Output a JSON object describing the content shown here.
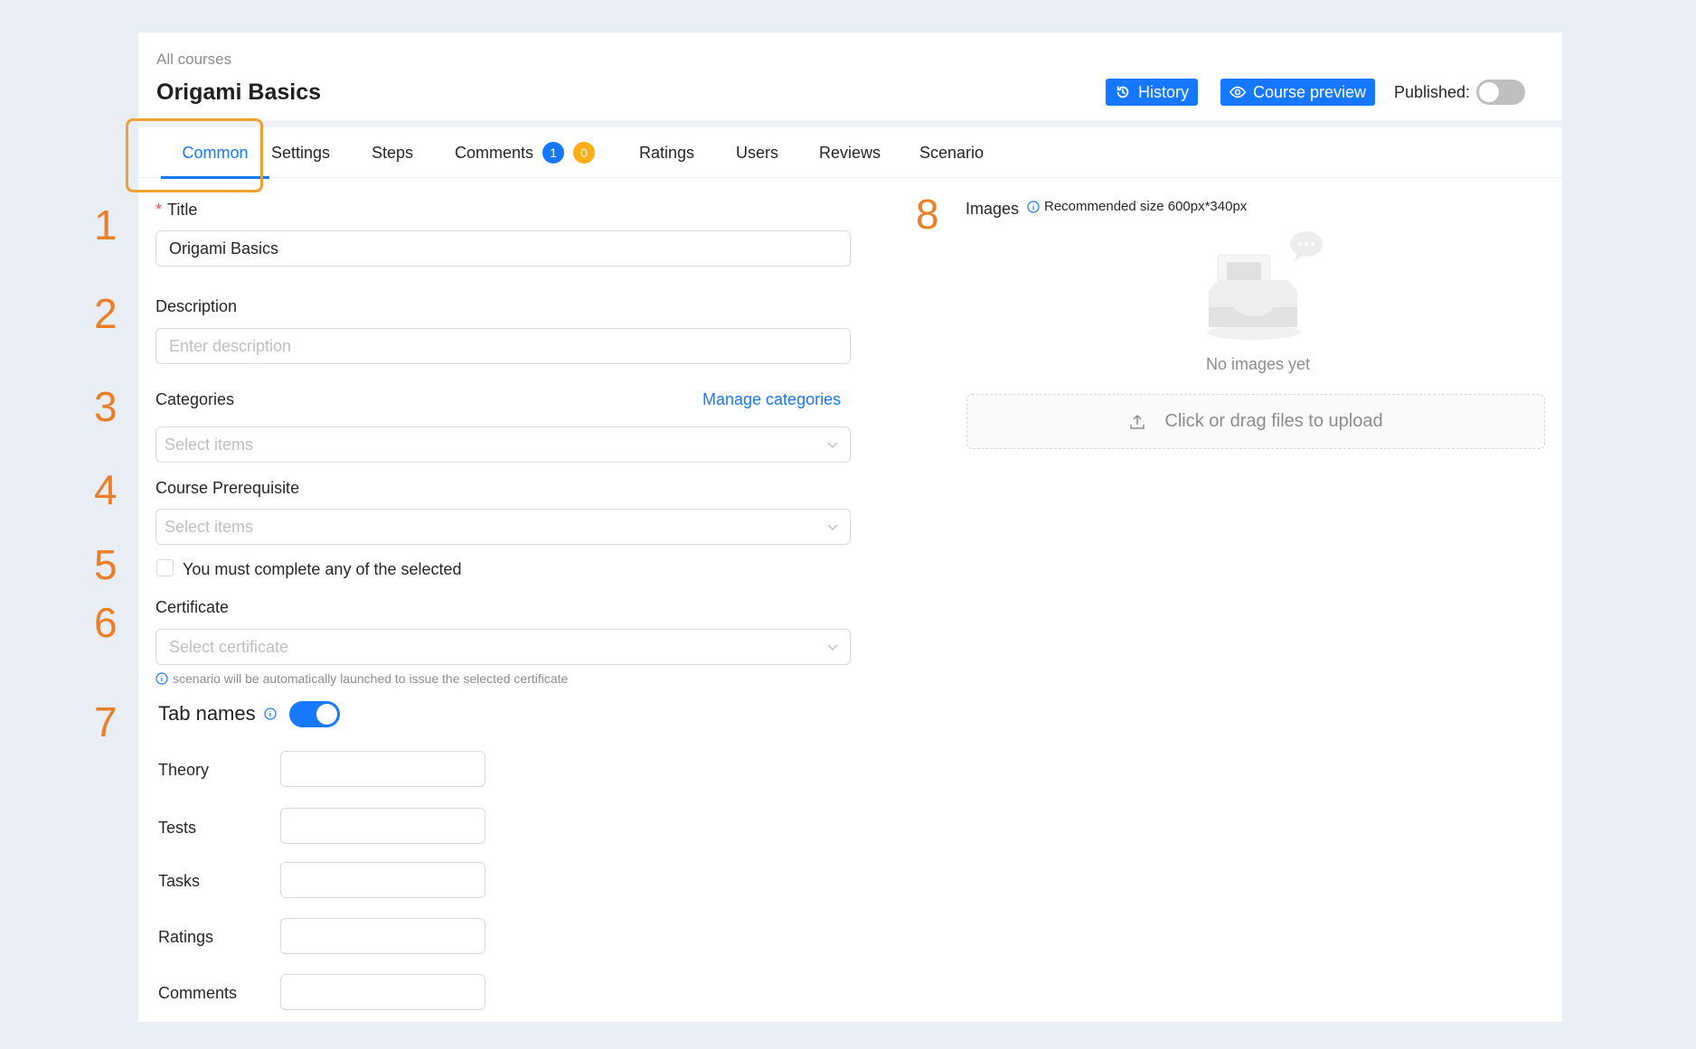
{
  "header": {
    "breadcrumb": "All courses",
    "title": "Origami Basics",
    "history_label": "History",
    "preview_label": "Course preview",
    "published_label": "Published:",
    "published": false
  },
  "tabs": [
    {
      "label": "Common"
    },
    {
      "label": "Settings"
    },
    {
      "label": "Steps"
    },
    {
      "label": "Comments",
      "badges": [
        "1",
        "0"
      ]
    },
    {
      "label": "Ratings"
    },
    {
      "label": "Users"
    },
    {
      "label": "Reviews"
    },
    {
      "label": "Scenario"
    }
  ],
  "markers": [
    "1",
    "2",
    "3",
    "4",
    "5",
    "6",
    "7",
    "8"
  ],
  "form": {
    "title_label": "Title",
    "title_required": "*",
    "title_value": "Origami Basics",
    "description_label": "Description",
    "description_placeholder": "Enter description",
    "categories_label": "Categories",
    "manage_categories": "Manage categories",
    "categories_placeholder": "Select items",
    "prerequisite_label": "Course Prerequisite",
    "prerequisite_placeholder": "Select items",
    "complete_any_label": "You must complete any of the selected",
    "certificate_label": "Certificate",
    "certificate_placeholder": "Select certificate",
    "certificate_hint": "scenario will be automatically launched to issue the selected certificate"
  },
  "tab_names": {
    "title": "Tab names",
    "enabled": true,
    "fields": [
      {
        "label": "Theory",
        "value": ""
      },
      {
        "label": "Tests",
        "value": ""
      },
      {
        "label": "Tasks",
        "value": ""
      },
      {
        "label": "Ratings",
        "value": ""
      },
      {
        "label": "Comments",
        "value": ""
      }
    ]
  },
  "images": {
    "label": "Images",
    "recommended": "Recommended size 600px*340px",
    "empty_text": "No images yet",
    "upload_text": "Click or drag files to upload"
  },
  "colors": {
    "primary": "#1677ff",
    "highlight": "#f0a030",
    "marker": "#e8802a",
    "badge_orange": "#faad14"
  }
}
